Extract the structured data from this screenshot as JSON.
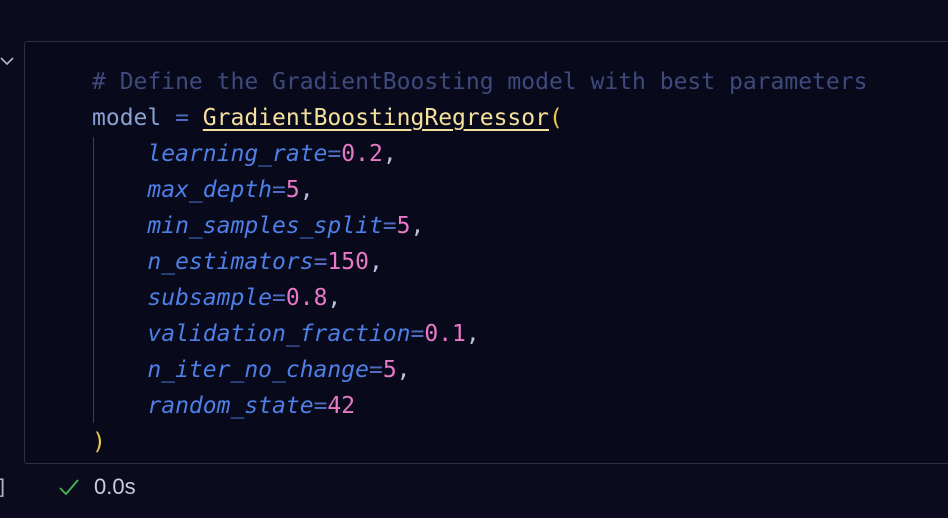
{
  "cell": {
    "lines": [
      {
        "comment": "# Define the GradientBoosting model with best parameters"
      },
      {
        "var": "model",
        "op": " = ",
        "fn": "GradientBoostingRegressor",
        "paren": "("
      },
      {
        "indent": "    ",
        "kw": "learning_rate",
        "eq": "=",
        "num": "0.2",
        "punct": ","
      },
      {
        "indent": "    ",
        "kw": "max_depth",
        "eq": "=",
        "num": "5",
        "punct": ","
      },
      {
        "indent": "    ",
        "kw": "min_samples_split",
        "eq": "=",
        "num": "5",
        "punct": ","
      },
      {
        "indent": "    ",
        "kw": "n_estimators",
        "eq": "=",
        "num": "150",
        "punct": ","
      },
      {
        "indent": "    ",
        "kw": "subsample",
        "eq": "=",
        "num": "0.8",
        "punct": ","
      },
      {
        "indent": "    ",
        "kw": "validation_fraction",
        "eq": "=",
        "num": "0.1",
        "punct": ","
      },
      {
        "indent": "    ",
        "kw": "n_iter_no_change",
        "eq": "=",
        "num": "5",
        "punct": ","
      },
      {
        "indent": "    ",
        "kw": "random_state",
        "eq": "=",
        "num": "42",
        "punct": ""
      },
      {
        "close": ")"
      }
    ]
  },
  "execution": {
    "bracket": "]",
    "status_icon": "check-icon",
    "status_color": "#3fb950",
    "time": "0.0s"
  }
}
